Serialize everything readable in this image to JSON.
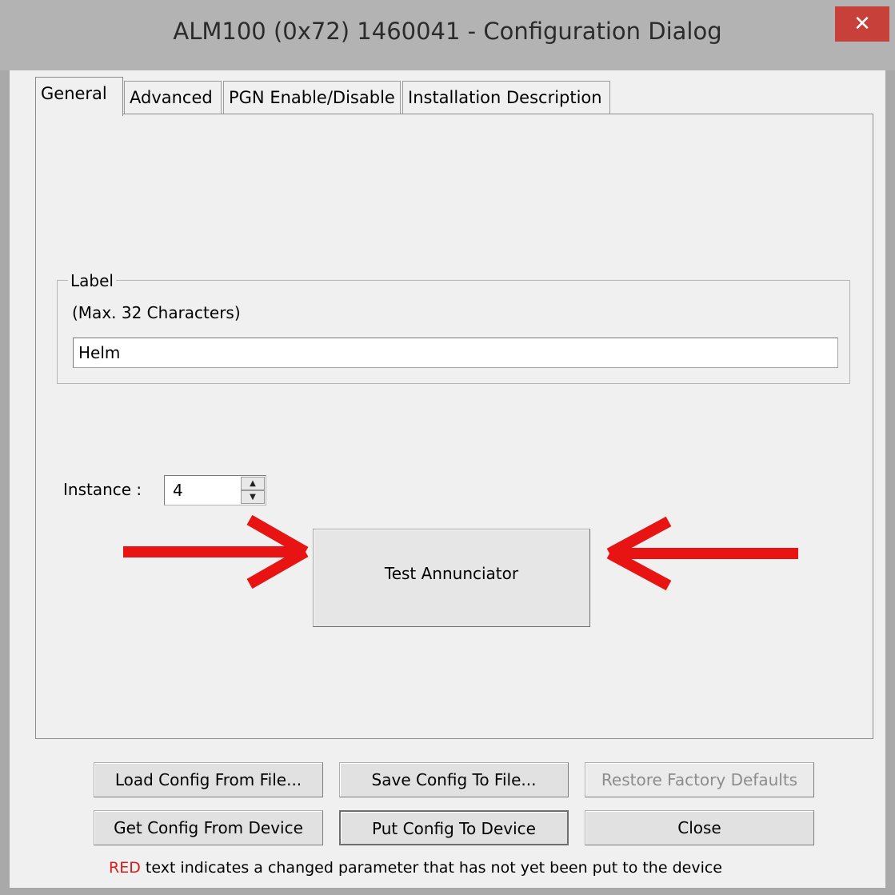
{
  "window": {
    "title": "ALM100 (0x72) 1460041 - Configuration Dialog",
    "close_glyph": "✕"
  },
  "tabs": [
    {
      "label": "General",
      "active": true
    },
    {
      "label": "Advanced",
      "active": false
    },
    {
      "label": "PGN Enable/Disable",
      "active": false
    },
    {
      "label": "Installation Description",
      "active": false
    }
  ],
  "general": {
    "label_group": {
      "title": "Label",
      "hint": "(Max. 32 Characters)",
      "value": "Helm"
    },
    "instance": {
      "label": "Instance :",
      "value": "4"
    },
    "test_button": "Test Annunciator",
    "annotation_color": "#e81414"
  },
  "buttons": {
    "load_config": "Load Config From File...",
    "save_config": "Save Config To File...",
    "restore_defaults": "Restore Factory Defaults",
    "get_config": "Get Config From Device",
    "put_config": "Put Config To Device",
    "close": "Close"
  },
  "footer": {
    "red_word": "RED",
    "rest": "text indicates a changed parameter that has not yet been put to the device"
  }
}
